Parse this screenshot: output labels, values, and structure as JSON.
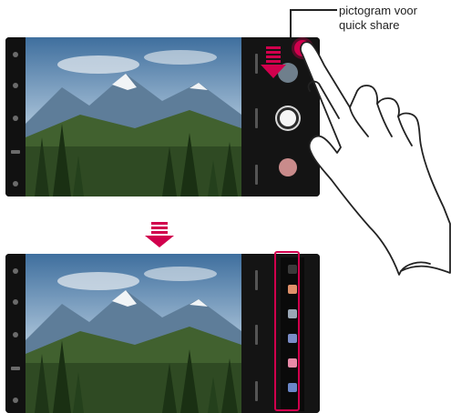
{
  "callout": {
    "line1": "pictogram voor",
    "line2": "quick share"
  },
  "colors": {
    "accent": "#d1004d",
    "phone_body": "#0d0d0d",
    "arrow": "#d1004d"
  },
  "icons": {
    "swipe_down_arrow": "arrow-down-striped",
    "step_arrow": "arrow-down-striped",
    "hand": "pointing-hand"
  }
}
